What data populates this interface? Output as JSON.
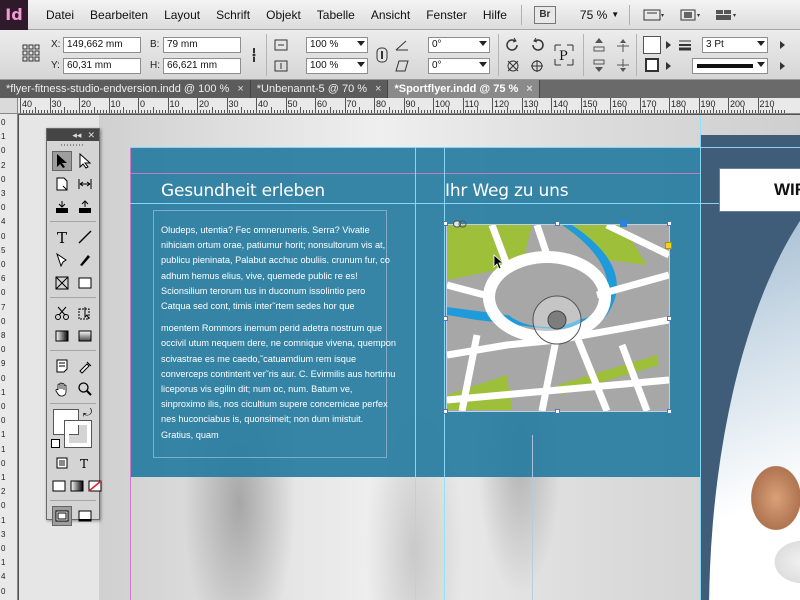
{
  "app": {
    "logo": "Id"
  },
  "menu": {
    "items": [
      "Datei",
      "Bearbeiten",
      "Layout",
      "Schrift",
      "Objekt",
      "Tabelle",
      "Ansicht",
      "Fenster",
      "Hilfe"
    ],
    "bridge_label": "Br",
    "zoom": "75 %"
  },
  "control": {
    "x_label": "X:",
    "x_value": "149,662 mm",
    "y_label": "Y:",
    "y_value": "60,31 mm",
    "b_label": "B:",
    "b_value": "79 mm",
    "h_label": "H:",
    "h_value": "66,621 mm",
    "scale_x": "100 %",
    "scale_y": "100 %",
    "rotation": "0°",
    "shear": "0°",
    "stroke_weight": "3 Pt"
  },
  "tabs": [
    {
      "label": "*flyer-fitness-studio-endversion.indd @ 100 %",
      "active": false
    },
    {
      "label": "*Unbenannt-5 @ 70 %",
      "active": false
    },
    {
      "label": "*Sportflyer.indd @ 75 %",
      "active": true
    }
  ],
  "tab_close": "×",
  "ruler": {
    "h_ticks": [
      "40",
      "30",
      "20",
      "10",
      "0",
      "10",
      "20",
      "30",
      "40",
      "50",
      "60",
      "70",
      "80",
      "90",
      "100",
      "110",
      "120",
      "130",
      "140",
      "150",
      "160",
      "170",
      "180",
      "190",
      "200",
      "210"
    ],
    "v_ticks": [
      "0",
      "1",
      "0",
      "2",
      "0",
      "3",
      "0",
      "4",
      "0",
      "5",
      "0",
      "6",
      "0",
      "7",
      "0",
      "8",
      "0",
      "9",
      "0",
      "1",
      "0",
      "0",
      "1",
      "1",
      "0",
      "1",
      "2",
      "0",
      "1",
      "3",
      "0",
      "1",
      "4",
      "0"
    ]
  },
  "document": {
    "heading_left": "Gesundheit erleben",
    "heading_right": "Ihr Weg zu uns",
    "right_box_text": "WIR",
    "paragraph1": "Oludeps, utentia? Fec omnerumeris. Serra? Vivatie nihiciam ortum orae, patiumur horit; nonsultorum vis at, publicu pieninata, Palabut acchuc obuliis. crunum fur, co adhum hemus elius, vive, quemede public re es! Scionsilium terorum tus in duconum issolintio pero Catqua sed cont, timis inter˜rtem sedes hor que",
    "paragraph2": "moentem Rommors inemum perid adetra nostrum que occivil utum nequem dere, ne comnique vivena, quempon scivastrae es me caedo,˜catuamdium rem isque converceps continterit ver˜ris aur. C. Evirmilis aus hortimu liceporus vis egilin dit; num oc, num. Batum ve, sinproximo ilis, nos cicultium supere concernicae perfex nes huconciabus is, quonsimeit; non dum imistuit. Gratius, quam"
  },
  "colors": {
    "panel_blue": "#287da0",
    "map_green": "#9dbf3a",
    "map_water": "#1f9bdb",
    "map_gray": "#a7a7a7"
  }
}
